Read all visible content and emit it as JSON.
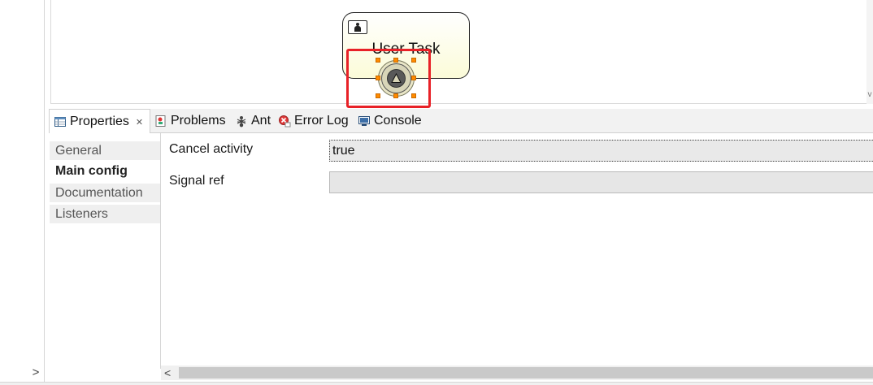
{
  "diagram": {
    "task_label": "User Task",
    "task_icon": "user-icon",
    "boundary_event_icon": "signal-icon",
    "highlight_color": "#e82127"
  },
  "tabs": [
    {
      "label": "Properties",
      "icon": "properties-icon",
      "active": true
    },
    {
      "label": "Problems",
      "icon": "problems-icon"
    },
    {
      "label": "Ant",
      "icon": "ant-icon"
    },
    {
      "label": "Error Log",
      "icon": "error-log-icon"
    },
    {
      "label": "Console",
      "icon": "console-icon"
    }
  ],
  "side_tabs": [
    {
      "label": "General"
    },
    {
      "label": "Main config",
      "selected": true
    },
    {
      "label": "Documentation"
    },
    {
      "label": "Listeners"
    }
  ],
  "form": {
    "cancel_activity_label": "Cancel activity",
    "cancel_activity_value": "true",
    "signal_ref_label": "Signal ref",
    "signal_ref_value": ""
  },
  "scroll": {
    "left_arrow": "<",
    "expand_arrow": ">",
    "down_arrow": "v"
  },
  "close_glyph": "✕"
}
